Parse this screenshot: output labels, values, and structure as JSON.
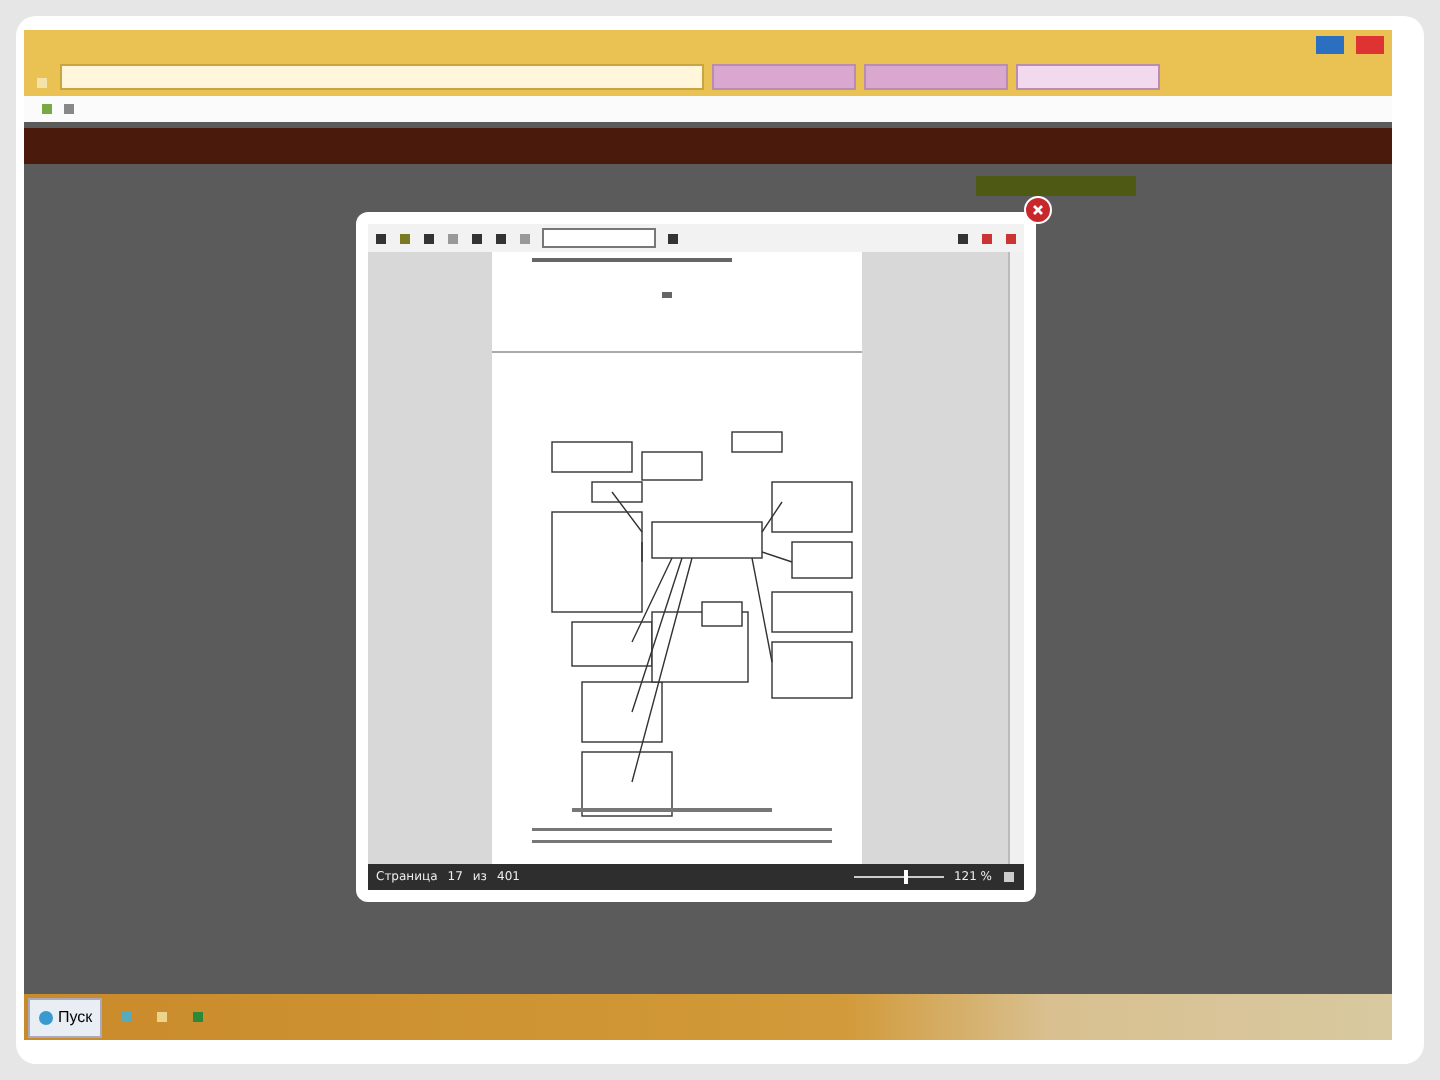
{
  "browser": {
    "tabs": [
      {
        "selected": false
      },
      {
        "selected": false
      },
      {
        "selected": true
      }
    ]
  },
  "viewer": {
    "page_label": "Страница",
    "page": "17",
    "of_label": "из",
    "total": "401",
    "zoom": "121 %",
    "level": 0.55
  },
  "taskbar": {
    "start": "Пуск"
  }
}
